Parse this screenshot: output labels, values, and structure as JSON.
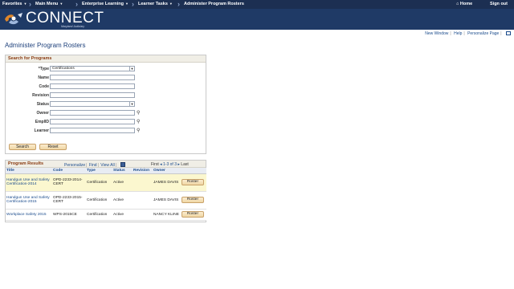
{
  "topnav": {
    "items": [
      "Favorites",
      "Main Menu",
      "Enterprise Learning",
      "Learner Tasks",
      "Administer Program Rosters"
    ],
    "home": "Home",
    "signout": "Sign out"
  },
  "brand": {
    "name": "CONNECT",
    "sub": "Maryland Judiciary"
  },
  "util_links": [
    "New Window",
    "Help",
    "Personalize Page"
  ],
  "page_title": "Administer Program Rosters",
  "search": {
    "title": "Search for Programs",
    "fields": {
      "type": {
        "label": "*Type",
        "value": "Certifications"
      },
      "name": {
        "label": "Name",
        "value": ""
      },
      "code": {
        "label": "Code",
        "value": ""
      },
      "revision": {
        "label": "Revision",
        "value": ""
      },
      "status": {
        "label": "Status",
        "value": ""
      },
      "owner": {
        "label": "Owner",
        "value": ""
      },
      "emplid": {
        "label": "EmplID",
        "value": ""
      },
      "learner": {
        "label": "Learner",
        "value": ""
      }
    },
    "search_label": "Search",
    "reset_label": "Reset"
  },
  "results": {
    "title": "Program Results",
    "personalize": "Personalize",
    "find": "Find",
    "view_all": "View All",
    "first": "First",
    "range": "1-3 of 3",
    "last": "Last",
    "columns": [
      "Title",
      "Code",
      "Type",
      "Status",
      "Revision",
      "Owner",
      ""
    ],
    "rows": [
      {
        "title": "Handgun Use and Safety Certification-2014",
        "code": "OPD-2233-2014-CERT",
        "type": "Certification",
        "status": "Active",
        "revision": "",
        "owner": "JAMES DAVIS",
        "action": "Roster"
      },
      {
        "title": "Handgun Use and Safety Certification-2015",
        "code": "OPD-2233-2015-CERT",
        "type": "Certification",
        "status": "Active",
        "revision": "",
        "owner": "JAMES DAVIS",
        "action": "Roster"
      },
      {
        "title": "Workplace Safety 2015",
        "code": "WPS-2015CE",
        "type": "Certification",
        "status": "Active",
        "revision": "",
        "owner": "NANCY KLINE",
        "action": "Roster"
      }
    ]
  }
}
